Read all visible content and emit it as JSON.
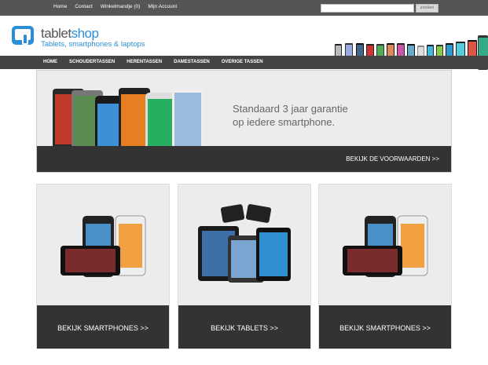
{
  "topbar": {
    "links": [
      "Home",
      "Contact",
      "Winkelmandje (0)",
      "Mijn Account"
    ],
    "search_placeholder": "",
    "search_button": "zoeken"
  },
  "logo": {
    "name_part1": "tablet",
    "name_part2": "shop",
    "tagline": "Tablets, smartphones & laptops",
    "icon": "tablet-touch-icon"
  },
  "nav": {
    "items": [
      "HOME",
      "SCHOUDERTASSEN",
      "HERENTASSEN",
      "DAMESTASSEN",
      "OVERIGE TASSEN"
    ]
  },
  "hero": {
    "line1": "Standaard 3 jaar garantie",
    "line2": "op iedere smartphone.",
    "link": "BEKIJK DE VOORWAARDEN >>"
  },
  "cards": [
    {
      "link": "BEKIJK SMARTPHONES >>",
      "image": "smartphones-image"
    },
    {
      "link": "BEKIJK TABLETS >>",
      "image": "tablets-image"
    },
    {
      "link": "BEKIJK SMARTPHONES >>",
      "image": "smartphones-image"
    }
  ],
  "colors": {
    "accent": "#2a8fd6",
    "dark": "#333333",
    "nav": "#444444",
    "topbar": "#555555"
  }
}
